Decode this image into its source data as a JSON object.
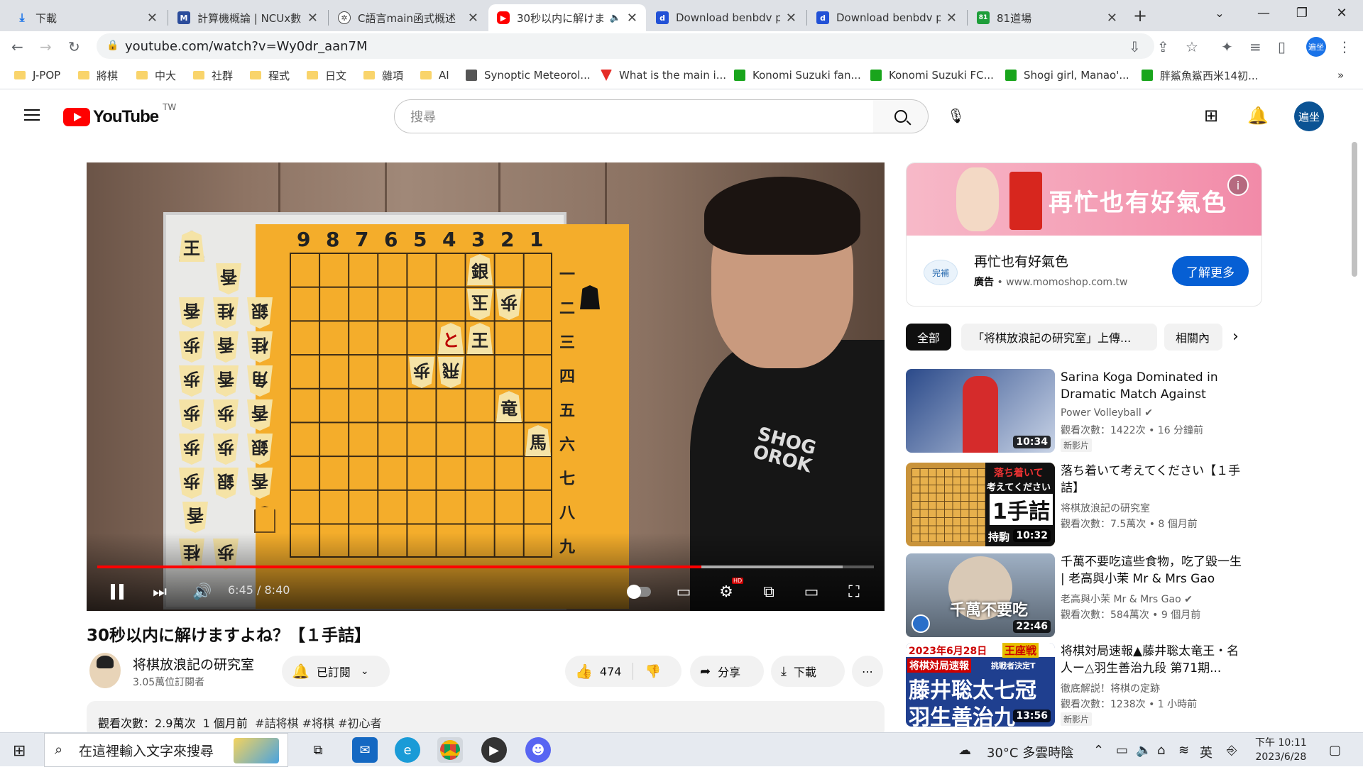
{
  "browser": {
    "tabs": [
      {
        "title": "下載",
        "favicon": "download-icon",
        "color": "#1a73e8"
      },
      {
        "title": "計算機概論 | NCUx數",
        "favicon": "m-icon",
        "color": "#2b4c9b"
      },
      {
        "title": "C語言main函式概述",
        "favicon": "openai-icon",
        "color": "#4a4a4a"
      },
      {
        "title": "30秒以内に解けま",
        "favicon": "youtube-icon",
        "color": "#ff0000",
        "audio": "speaker-icon"
      },
      {
        "title": "Download benbdv p",
        "favicon": "d-icon",
        "color": "#2251d6"
      },
      {
        "title": "Download benbdv p",
        "favicon": "d-icon",
        "color": "#2251d6"
      },
      {
        "title": "81道場",
        "favicon": "81-icon",
        "color": "#1e9e3a"
      }
    ],
    "url": "youtube.com/watch?v=Wy0dr_aan7M",
    "profile_label": "遍坐",
    "bookmarks": [
      {
        "label": "J-POP",
        "type": "folder"
      },
      {
        "label": "將棋",
        "type": "folder"
      },
      {
        "label": "中大",
        "type": "folder"
      },
      {
        "label": "社群",
        "type": "folder"
      },
      {
        "label": "程式",
        "type": "folder"
      },
      {
        "label": "日文",
        "type": "folder"
      },
      {
        "label": "雜項",
        "type": "folder"
      },
      {
        "label": "AI",
        "type": "folder"
      },
      {
        "label": "Synoptic Meteorol...",
        "type": "page"
      },
      {
        "label": "What is the main i...",
        "type": "page"
      },
      {
        "label": "Konomi Suzuki fan...",
        "type": "page"
      },
      {
        "label": "Konomi Suzuki FC...",
        "type": "page"
      },
      {
        "label": "Shogi girl, Manao'...",
        "type": "page"
      },
      {
        "label": "胖鯊魚鯊西米14初...",
        "type": "page"
      }
    ],
    "more_bookmarks": "»"
  },
  "youtube": {
    "logo_text": "YouTube",
    "country_code": "TW",
    "search_placeholder": "搜尋",
    "avatar_label": "遍坐"
  },
  "player": {
    "time_display": "6:45 / 8:40",
    "progress_fraction": 0.778,
    "hd_label": "HD",
    "board": {
      "col_numbers": [
        "9",
        "8",
        "7",
        "6",
        "5",
        "4",
        "3",
        "2",
        "1"
      ],
      "row_numbers": [
        "一",
        "二",
        "三",
        "四",
        "五",
        "六",
        "七",
        "八",
        "九"
      ],
      "pieces": [
        {
          "char": "銀",
          "inv": false
        },
        {
          "char": "玉",
          "inv": true
        },
        {
          "char": "歩",
          "inv": true
        },
        {
          "char": "と",
          "inv": false
        },
        {
          "char": "王",
          "inv": true
        },
        {
          "char": "歩",
          "inv": true
        },
        {
          "char": "飛",
          "inv": true
        },
        {
          "char": "竜",
          "inv": false
        },
        {
          "char": "馬",
          "inv": false
        }
      ],
      "hand_pieces": [
        "王",
        "香",
        "香",
        "桂",
        "銀",
        "歩",
        "香",
        "桂",
        "歩",
        "香",
        "角",
        "歩",
        "歩",
        "香",
        "歩",
        "歩",
        "銀",
        "歩",
        "銀",
        "香",
        "香",
        "桂",
        "歩"
      ]
    },
    "shirt_print": "SHOG OROK"
  },
  "video": {
    "title": "30秒以内に解けますよね？【１手詰】",
    "channel_name": "将棋放浪記の研究室",
    "subscribers": "3.05萬位訂閱者",
    "subscribed_label": "已訂閱",
    "likes": "474",
    "share_label": "分享",
    "download_label": "下載",
    "more_label": "⋯",
    "views": "觀看次數：2.9萬次",
    "age": "1 個月前",
    "hashtags": [
      "#詰将棋",
      "#将棋",
      "#初心者"
    ]
  },
  "ad": {
    "banner_text": "再忙也有好氣色",
    "title": "再忙也有好氣色",
    "badge": "廣告",
    "domain": "www.momoshop.com.tw",
    "cta": "了解更多",
    "info_icon": "i",
    "logo_text": "完補"
  },
  "chips": [
    {
      "label": "全部",
      "active": true
    },
    {
      "label": "「将棋放浪記の研究室」上傳...",
      "active": false
    },
    {
      "label": "相關內",
      "active": false
    }
  ],
  "recommendations": [
    {
      "title": "Sarina Koga Dominated in Dramatic Match Against Turke...",
      "channel": "Power Volleyball",
      "verified": true,
      "meta": "觀看次數：1422次 • 16 分鐘前",
      "badge": "新影片",
      "duration": "10:34",
      "thumb_color": "#2b4a8a"
    },
    {
      "title": "落ち着いて考えてください【１手詰】",
      "channel": "将棋放浪記の研究室",
      "verified": false,
      "meta": "觀看次數：7.5萬次 • 8 個月前",
      "badge": "",
      "duration": "10:32",
      "thumb_color": "#c9933a",
      "thumb_text": [
        "落ち着いて",
        "考えてください",
        "1手詰",
        "持駒"
      ]
    },
    {
      "title": "千萬不要吃這些食物，吃了毀一生 | 老高與小茉 Mr & Mrs Gao",
      "channel": "老高與小茉 Mr & Mrs Gao",
      "verified": true,
      "meta": "觀看次數：584萬次 • 9 個月前",
      "badge": "",
      "duration": "22:46",
      "thumb_color": "#8a9bb0",
      "thumb_text": [
        "千萬不要吃"
      ]
    },
    {
      "title": "将棋対局速報▲藤井聡太竜王・名人ー△羽生善治九段 第71期...",
      "channel": "徹底解説！将棋の定跡",
      "verified": false,
      "meta": "觀看次數：1238次 • 1 小時前",
      "badge": "新影片",
      "duration": "13:56",
      "thumb_color": "#1f3f8f",
      "thumb_text": [
        "2023年6月28日",
        "王座戦",
        "将棋対局速報",
        "挑戦者決定T",
        "藤井聡太七冠",
        "羽生善治九"
      ]
    }
  ],
  "taskbar": {
    "search_placeholder": "在這裡輸入文字來搜尋",
    "weather": "30°C  多雲時陰",
    "ime": "英",
    "time": "下午 10:11",
    "date": "2023/6/28"
  }
}
